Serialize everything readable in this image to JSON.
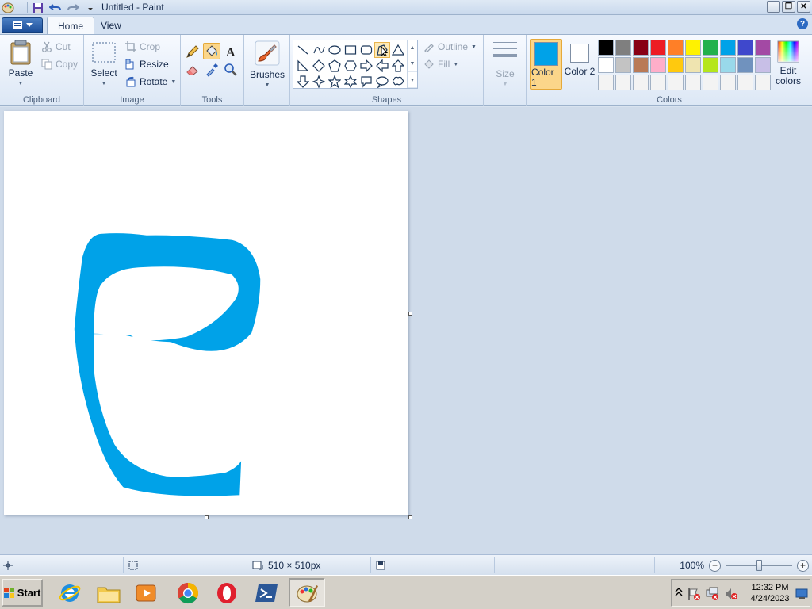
{
  "window": {
    "title": "Untitled - Paint",
    "minimize_label": "_",
    "restore_label": "❐",
    "close_label": "✕"
  },
  "tabs": [
    {
      "label": "Home",
      "active": true
    },
    {
      "label": "View",
      "active": false
    }
  ],
  "help_label": "?",
  "ribbon": {
    "clipboard": {
      "group_label": "Clipboard",
      "paste": "Paste",
      "cut": "Cut",
      "copy": "Copy"
    },
    "image": {
      "group_label": "Image",
      "select": "Select",
      "crop": "Crop",
      "resize": "Resize",
      "rotate": "Rotate"
    },
    "tools": {
      "group_label": "Tools",
      "items": [
        "pencil-icon",
        "fill-bucket-icon",
        "text-icon",
        "eraser-icon",
        "color-picker-icon",
        "magnifier-icon"
      ],
      "selected": "fill-bucket-icon"
    },
    "brushes": {
      "label": "Brushes"
    },
    "shapes": {
      "group_label": "Shapes",
      "outline": "Outline",
      "fill": "Fill",
      "items": [
        "line",
        "curve",
        "oval",
        "rectangle",
        "rounded-rectangle",
        "polygon",
        "triangle",
        "right-triangle",
        "diamond",
        "pentagon",
        "hexagon",
        "right-arrow",
        "left-arrow",
        "up-arrow",
        "down-arrow",
        "four-point-star",
        "five-point-star",
        "six-point-star",
        "rounded-callout",
        "oval-callout",
        "cloud-callout"
      ]
    },
    "size": {
      "label": "Size"
    },
    "colors": {
      "group_label": "Colors",
      "color1_label": "Color 1",
      "color1_value": "#00a2e8",
      "color2_label": "Color 2",
      "color2_value": "#ffffff",
      "edit_colors": "Edit colors",
      "palette": [
        "#000000",
        "#7f7f7f",
        "#880015",
        "#ed1c24",
        "#ff7f27",
        "#fff200",
        "#22b14c",
        "#00a2e8",
        "#3f48cc",
        "#a349a4",
        "#ffffff",
        "#c3c3c3",
        "#b97a57",
        "#ffaec9",
        "#ffc90e",
        "#efe4b0",
        "#b5e61d",
        "#99d9ea",
        "#7092be",
        "#c8bfe7",
        "#f3f3f3",
        "#f3f3f3",
        "#f3f3f3",
        "#f3f3f3",
        "#f3f3f3",
        "#f3f3f3",
        "#f3f3f3",
        "#f3f3f3",
        "#f3f3f3",
        "#f3f3f3"
      ]
    }
  },
  "canvas": {
    "drawing": "letter-e-stroke",
    "stroke_color": "#00a2e8",
    "background": "#ffffff"
  },
  "statusbar": {
    "image_size": "510 × 510px",
    "zoom": "100%",
    "zoom_minus": "−",
    "zoom_plus": "+"
  },
  "taskbar": {
    "start_label": "Start",
    "clock_time": "12:32 PM",
    "clock_date": "4/24/2023"
  }
}
